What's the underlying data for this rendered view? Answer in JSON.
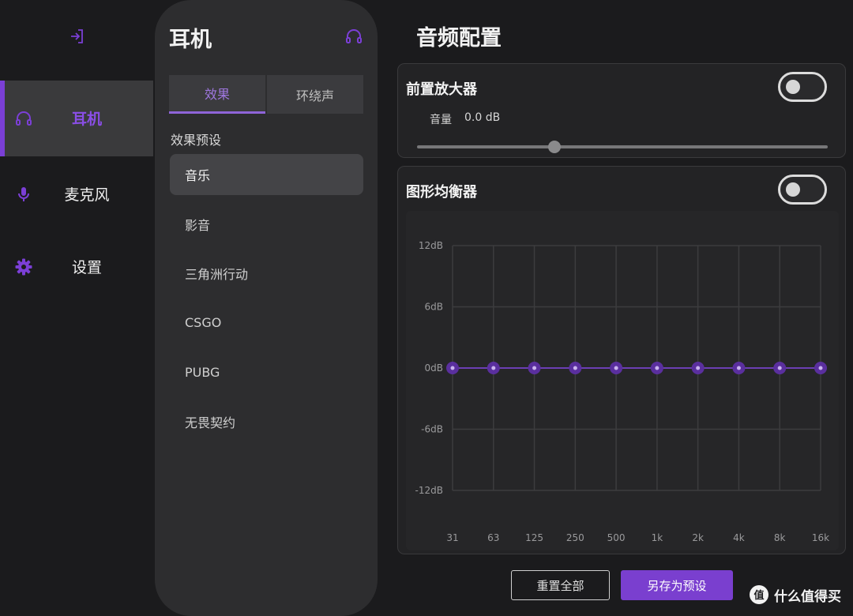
{
  "nav": {
    "items": [
      {
        "label": "耳机",
        "icon": "headphone-icon",
        "active": true
      },
      {
        "label": "麦克风",
        "icon": "microphone-icon",
        "active": false
      },
      {
        "label": "设置",
        "icon": "gear-icon",
        "active": false
      }
    ]
  },
  "device": {
    "title": "耳机",
    "tabs": [
      {
        "label": "效果",
        "active": true
      },
      {
        "label": "环绕声",
        "active": false
      }
    ],
    "preset_header": "效果预设",
    "presets": [
      {
        "label": "音乐",
        "active": true
      },
      {
        "label": "影音",
        "active": false
      },
      {
        "label": "三角洲行动",
        "active": false
      },
      {
        "label": "CSGO",
        "active": false
      },
      {
        "label": "PUBG",
        "active": false
      },
      {
        "label": "无畏契约",
        "active": false
      }
    ]
  },
  "main": {
    "title": "音频配置",
    "preamp": {
      "title": "前置放大器",
      "enabled": false,
      "volume_label": "音量",
      "volume_value": "0.0 dB",
      "slider_fraction": 0.335
    },
    "equalizer": {
      "title": "图形均衡器",
      "enabled": false
    },
    "buttons": {
      "reset": "重置全部",
      "save_preset": "另存为预设"
    }
  },
  "chart_data": {
    "type": "line",
    "x": [
      "31",
      "63",
      "125",
      "250",
      "500",
      "1k",
      "2k",
      "4k",
      "8k",
      "16k"
    ],
    "series": [
      {
        "values": [
          0,
          0,
          0,
          0,
          0,
          0,
          0,
          0,
          0,
          0
        ]
      }
    ],
    "ylim": [
      -12,
      12
    ],
    "y_ticks": [
      12,
      6,
      0,
      -6,
      -12
    ],
    "y_tick_labels": [
      "12dB",
      "6dB",
      "0dB",
      "-6dB",
      "-12dB"
    ],
    "grid": true
  },
  "colors": {
    "accent": "#7b3fd6",
    "eq_line": "#6b3fb3",
    "eq_point": "#5a2f9e",
    "grid": "#3c3c3e"
  },
  "watermark": {
    "logo_text": "值",
    "text": "什么值得买"
  }
}
